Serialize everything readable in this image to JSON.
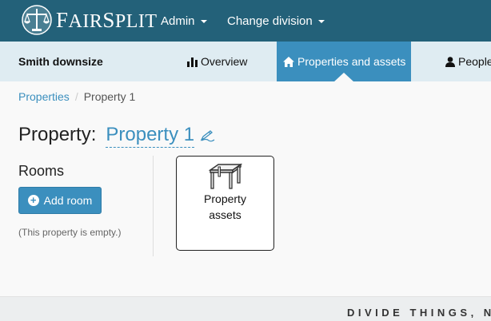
{
  "brand": {
    "name_first": "F",
    "name_mid": "AIR",
    "name_s": "S",
    "name_rest": "PLIT",
    "logo_icon": "scales-icon"
  },
  "topnav": {
    "admin": "Admin",
    "change_division": "Change division"
  },
  "subnav": {
    "project": "Smith downsize",
    "tabs": [
      {
        "label": "Overview",
        "icon": "bar-chart-icon",
        "active": false
      },
      {
        "label": "Properties and assets",
        "icon": "home-icon",
        "active": true
      },
      {
        "label": "People",
        "icon": "user-icon",
        "active": false
      }
    ]
  },
  "breadcrumb": {
    "parent": "Properties",
    "current": "Property 1"
  },
  "heading": {
    "label": "Property:",
    "name": "Property 1"
  },
  "rooms": {
    "title": "Rooms",
    "add_button": "Add room",
    "empty_note": "(This property is empty.)"
  },
  "asset_card": {
    "label_line1": "Property",
    "label_line2": "assets",
    "icon": "table-icon"
  },
  "footer": {
    "tagline": "DIVIDE THINGS, N"
  },
  "colors": {
    "navbar": "#236179",
    "accent": "#3b8fbe",
    "subnav": "#dfecf2"
  }
}
